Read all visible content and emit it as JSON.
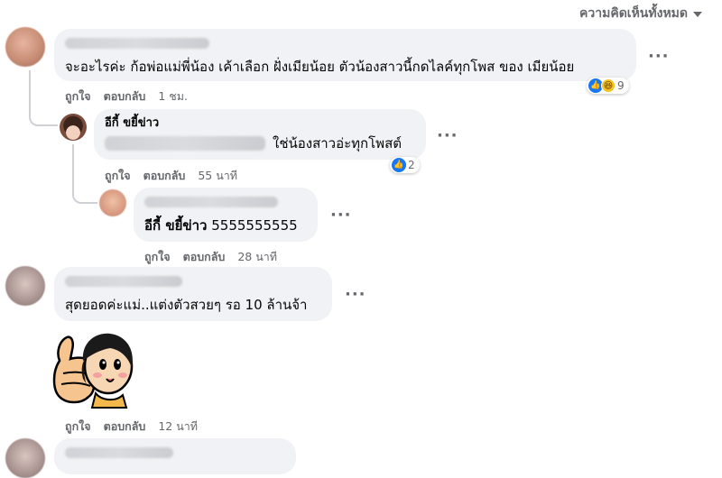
{
  "filter": {
    "label": "ความคิดเห็นทั้งหมด"
  },
  "comments": [
    {
      "text": "จะอะไรค่ะ ก้อพ่อแม่พี่น้อง เค้าเลือก ฝั่งเมียน้อย ตัวน้องสาวนี้กดไลค์ทุกโพส ของ เมียน้อย",
      "like": "ถูกใจ",
      "reply": "ตอบกลับ",
      "time": "1 ชม.",
      "reaction_count": "9"
    },
    {
      "name": "อีกี้ ขยี้ข่าว",
      "text": "ใช่น้องสาวอ่ะทุกโพสต์",
      "like": "ถูกใจ",
      "reply": "ตอบกลับ",
      "time": "55 นาที",
      "reaction_count": "2"
    },
    {
      "tag": "อีกี้ ขยี้ข่าว",
      "text": "5555555555",
      "like": "ถูกใจ",
      "reply": "ตอบกลับ",
      "time": "28 นาที"
    },
    {
      "text": "สุดยอดค่ะแม่..แต่งตัวสวยๆ รอ 10 ล้านจ้า",
      "like": "ถูกใจ",
      "reply": "ตอบกลับ",
      "time": "12 นาที"
    }
  ],
  "icons": {
    "like": "like-icon",
    "haha": "haha-icon",
    "more": "more-options-icon"
  },
  "colors": {
    "accent": "#1877f2",
    "bubble": "#f0f2f5",
    "meta": "#65676b"
  }
}
